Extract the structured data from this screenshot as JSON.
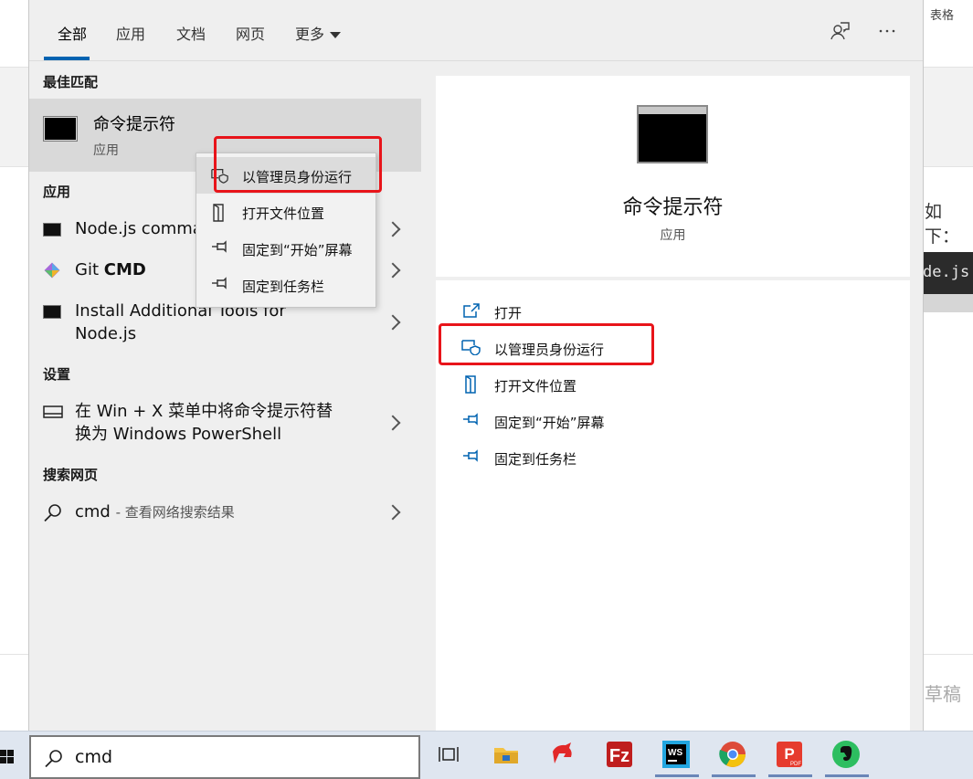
{
  "background_app": {
    "toolbar_label": "表格",
    "text_snippet": "如下：",
    "code_snippet": "de.js",
    "draft_label": "草稿"
  },
  "tabs": [
    {
      "label": "全部"
    },
    {
      "label": "应用"
    },
    {
      "label": "文档"
    },
    {
      "label": "网页"
    },
    {
      "label": "更多"
    }
  ],
  "header_icons": [
    "feedback-icon",
    "more-options-icon"
  ],
  "best_match": {
    "section_title": "最佳匹配",
    "title": "命令提示符",
    "subtitle": "应用"
  },
  "apps": {
    "section_title": "应用",
    "items": [
      {
        "label": "Node.js comma"
      },
      {
        "label_prefix": "Git ",
        "label_bold": "CMD"
      },
      {
        "label": "Install Additional Tools for",
        "label2": "Node.js"
      }
    ]
  },
  "settings": {
    "section_title": "设置",
    "item_line1": "在 Win + X 菜单中将命令提示符替",
    "item_line2": "换为 Windows PowerShell"
  },
  "web": {
    "section_title": "搜索网页",
    "query": "cmd",
    "suffix": "- 查看网络搜索结果"
  },
  "context_menu": {
    "items": [
      {
        "label": "以管理员身份运行",
        "icon": "shield-icon"
      },
      {
        "label": "打开文件位置",
        "icon": "file-location-icon"
      },
      {
        "label": "固定到“开始”屏幕",
        "icon": "pin-icon"
      },
      {
        "label": "固定到任务栏",
        "icon": "pin-icon"
      }
    ]
  },
  "preview": {
    "title": "命令提示符",
    "subtitle": "应用",
    "actions": [
      {
        "label": "打开",
        "icon": "open-icon"
      },
      {
        "label": "以管理员身份运行",
        "icon": "shield-icon"
      },
      {
        "label": "打开文件位置",
        "icon": "file-location-icon"
      },
      {
        "label": "固定到“开始”屏幕",
        "icon": "pin-icon"
      },
      {
        "label": "固定到任务栏",
        "icon": "pin-icon"
      }
    ]
  },
  "taskbar": {
    "search_value": "cmd",
    "apps": [
      "task-view-icon",
      "file-explorer-icon",
      "app-icon",
      "filezilla-icon",
      "webstorm-icon",
      "chrome-icon",
      "pdf-reader-icon",
      "evernote-icon"
    ]
  },
  "colors": {
    "accent": "#0063b1",
    "annotation_red": "#e8141a",
    "taskbar_bg": "#dfe6f0",
    "selected_row": "#d9d9d9"
  }
}
